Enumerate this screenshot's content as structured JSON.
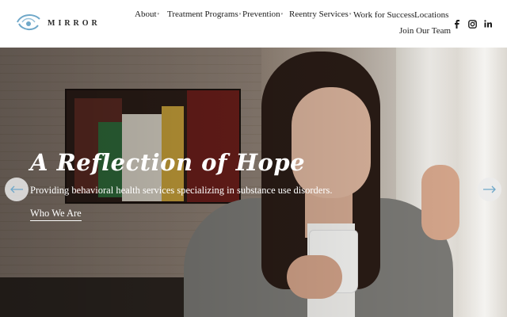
{
  "brand": {
    "name": "MIRROR"
  },
  "nav": {
    "about": "About",
    "treatment": "Treatment Programs",
    "prevention": "Prevention",
    "reentry": "Reentry Services",
    "work": "Work for Success",
    "locations": "Locations",
    "join": "Join Our Team"
  },
  "social": [
    "facebook-icon",
    "instagram-icon",
    "linkedin-icon"
  ],
  "hero": {
    "headline": "A Reflection of Hope",
    "subtext": "Providing behavioral health services specializing in substance use disorders.",
    "cta": "Who We Are"
  },
  "colors": {
    "accent": "#6fa8c9",
    "text": "#1c1c1c",
    "overlay_text": "#ffffff"
  }
}
